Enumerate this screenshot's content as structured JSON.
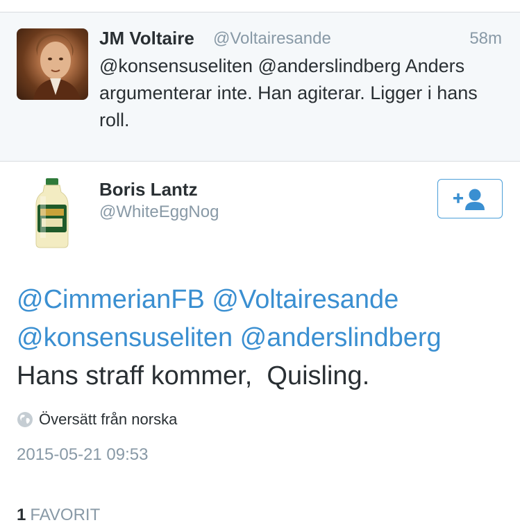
{
  "parent_tweet": {
    "name": "JM Voltaire",
    "handle": "@Voltairesande",
    "time": "58m",
    "text": "@konsensuseliten @anderslindberg Anders argumenterar inte. Han agiterar. Ligger i hans roll."
  },
  "author": {
    "name": "Boris Lantz",
    "handle": "@WhiteEggNog",
    "avatar_icon": "eggnog-bottle-icon",
    "follow_icon": "add-user-icon"
  },
  "tweet": {
    "mentions": [
      "@CimmerianFB",
      "@Voltairesande",
      "@konsensuseliten",
      "@anderslindberg"
    ],
    "body": "Hans straff kommer,  Quisling."
  },
  "translate": {
    "icon": "globe-icon",
    "label": "Översätt från norska"
  },
  "timestamp": "2015-05-21 09:53",
  "favorites": {
    "count": "1",
    "label": "FAVORIT"
  },
  "colors": {
    "link": "#3a8fd1",
    "text": "#292f33",
    "muted": "#8899a6",
    "parent_bg": "#f5f8fa"
  }
}
